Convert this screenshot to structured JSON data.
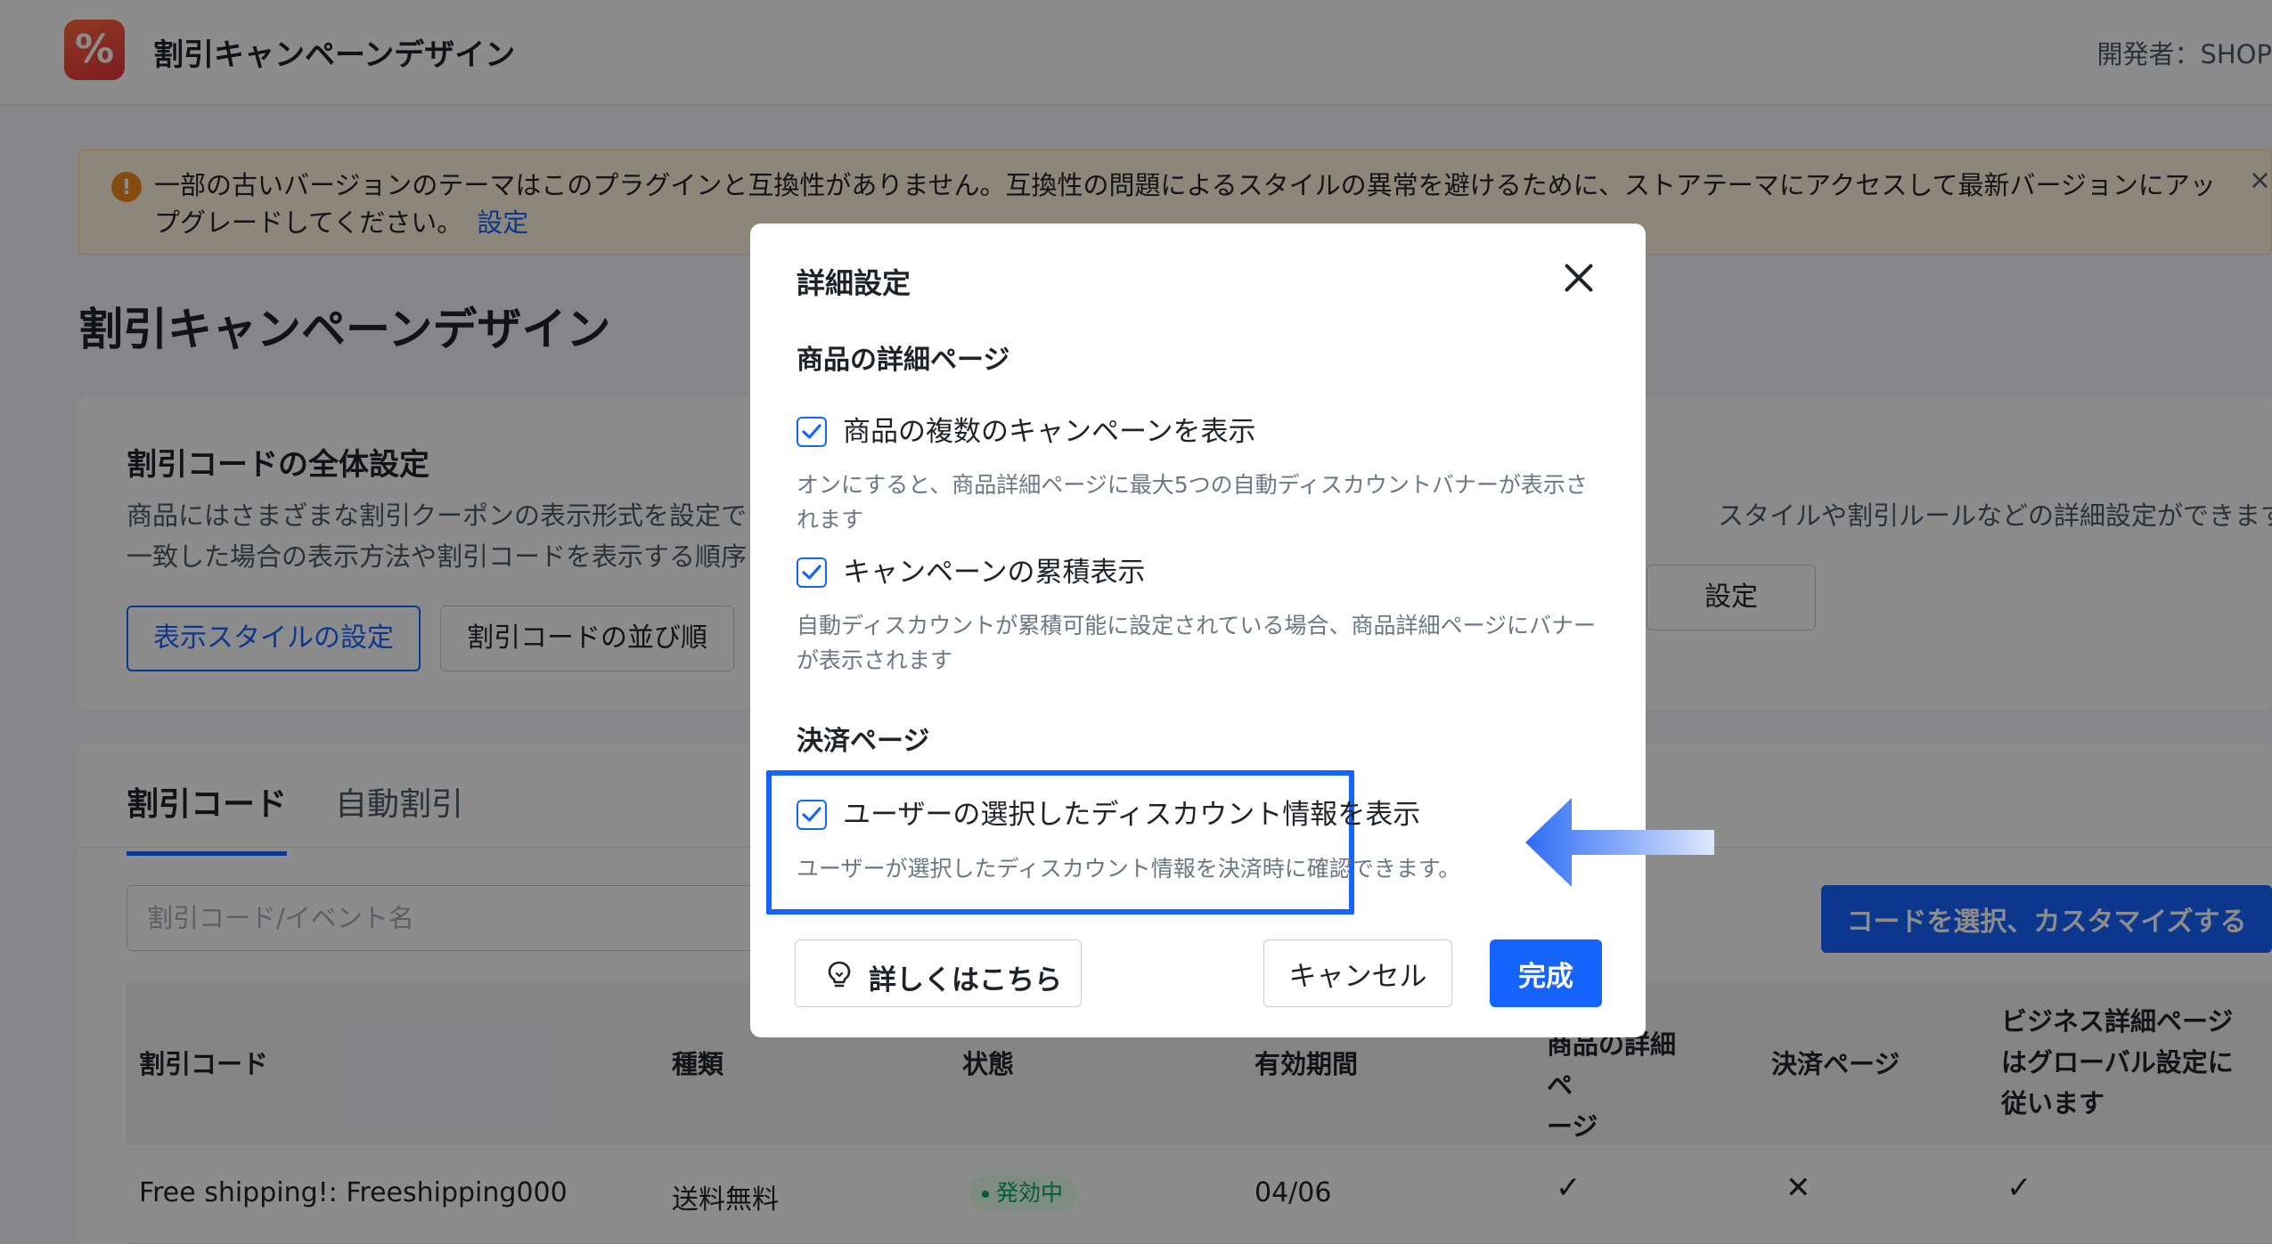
{
  "app": {
    "logo_glyph": "%",
    "title": "割引キャンペーンデザイン",
    "developer": "開発者：SHOP"
  },
  "warning": {
    "text": "一部の古いバージョンのテーマはこのプラグインと互換性がありません。互換性の問題によるスタイルの異常を避けるために、ストアテーマにアクセスして最新バージョンにアップグレードしてください。",
    "link": "設定"
  },
  "page": {
    "title": "割引キャンペーンデザイン"
  },
  "global_settings": {
    "title": "割引コードの全体設定",
    "desc_left_1": "商品にはさまざまな割引クーポンの表示形式を設定で",
    "desc_left_2": "一致した場合の表示方法や割引コードを表示する順序",
    "desc_right": "スタイルや割引ルールなどの詳細設定ができます。",
    "style_button": "表示スタイルの設定",
    "order_button": "割引コードの並び順",
    "detail_button_partial": "設定"
  },
  "codes": {
    "tabs": [
      "割引コード",
      "自動割引"
    ],
    "search_placeholder": "割引コード/イベント名",
    "customize_button": "コードを選択、カスタマイズする",
    "columns": {
      "code": "割引コード",
      "type": "種類",
      "status": "状態",
      "period": "有効期間",
      "product_page": "商品の詳細ペ\nージ",
      "checkout": "決済ページ",
      "business": "ビジネス詳細ページ\nはグローバル設定に\n従います"
    },
    "rows": [
      {
        "code": "Free shipping!: Freeshipping000",
        "type": "送料無料",
        "status": "発効中",
        "period": "04/06",
        "product_page": "✓",
        "checkout": "✕",
        "business": "✓"
      }
    ]
  },
  "modal": {
    "title": "詳細設定",
    "section_product": "商品の詳細ページ",
    "opt_multi": {
      "label": "商品の複数のキャンペーンを表示",
      "help_1": "オンにすると、商品詳細ページに最大5つの自動ディスカウントバナーが表示さ",
      "help_2": "れます",
      "checked": true
    },
    "opt_stack": {
      "label": "キャンペーンの累積表示",
      "help_1": "自動ディスカウントが累積可能に設定されている場合、商品詳細ページにバナー",
      "help_2": "が表示されます",
      "checked": true
    },
    "section_checkout": "決済ページ",
    "opt_user": {
      "label": "ユーザーの選択したディスカウント情報を表示",
      "help_1": "ユーザーが選択したディスカウント情報を決済時に確認できます。",
      "checked": true
    },
    "learn_more": "詳しくはこちら",
    "cancel": "キャンセル",
    "done": "完成"
  },
  "colors": {
    "accent": "#1664ff",
    "warning_bg": "#fff4e0",
    "success": "#00a870"
  },
  "icons": {
    "close": "close-icon",
    "check": "checkmark-icon",
    "bulb": "lightbulb-icon",
    "arrow": "left-arrow-icon"
  }
}
